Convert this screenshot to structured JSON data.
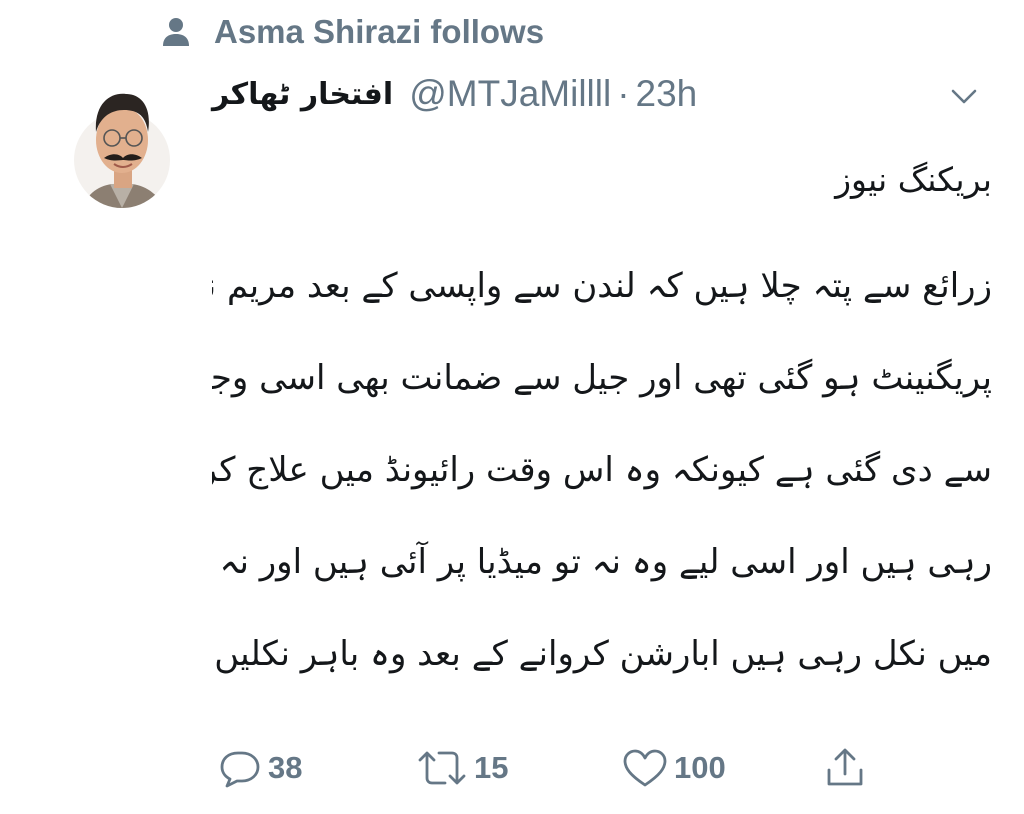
{
  "social_context": {
    "text": "Asma Shirazi follows",
    "icon": "person-icon"
  },
  "tweet": {
    "author_name": "افتخار ٹھاکر",
    "handle": "@MTJaMillll",
    "separator": "·",
    "time": "23h",
    "avatar_icon": "avatar",
    "heading": "بریکنگ نیوز",
    "lines": [
      "زرائع سے پتہ چلا ہیں کہ لندن سے واپسی کے بعد مریم نواز",
      "پریگنینٹ ہو گئی تھی اور جیل سے ضمانت بھی اسی وجہ",
      "سے دی گئی ہے کیونکہ وہ اس وقت رائیونڈ میں علاج کروا",
      "رہی ہیں اور اسی لیے وہ نہ تو میڈیا پر آئی ہیں اور نہ پبلک",
      "میں نکل رہی ہیں ابارشن کروانے کے بعد وہ باہر نکلیں گی"
    ]
  },
  "actions": {
    "reply_count": "38",
    "retweet_count": "15",
    "like_count": "100",
    "icons": [
      "reply-icon",
      "retweet-icon",
      "like-icon",
      "share-icon"
    ]
  },
  "colors": {
    "secondary_text": "#657786",
    "primary_text": "#14171a",
    "background": "#ffffff"
  }
}
